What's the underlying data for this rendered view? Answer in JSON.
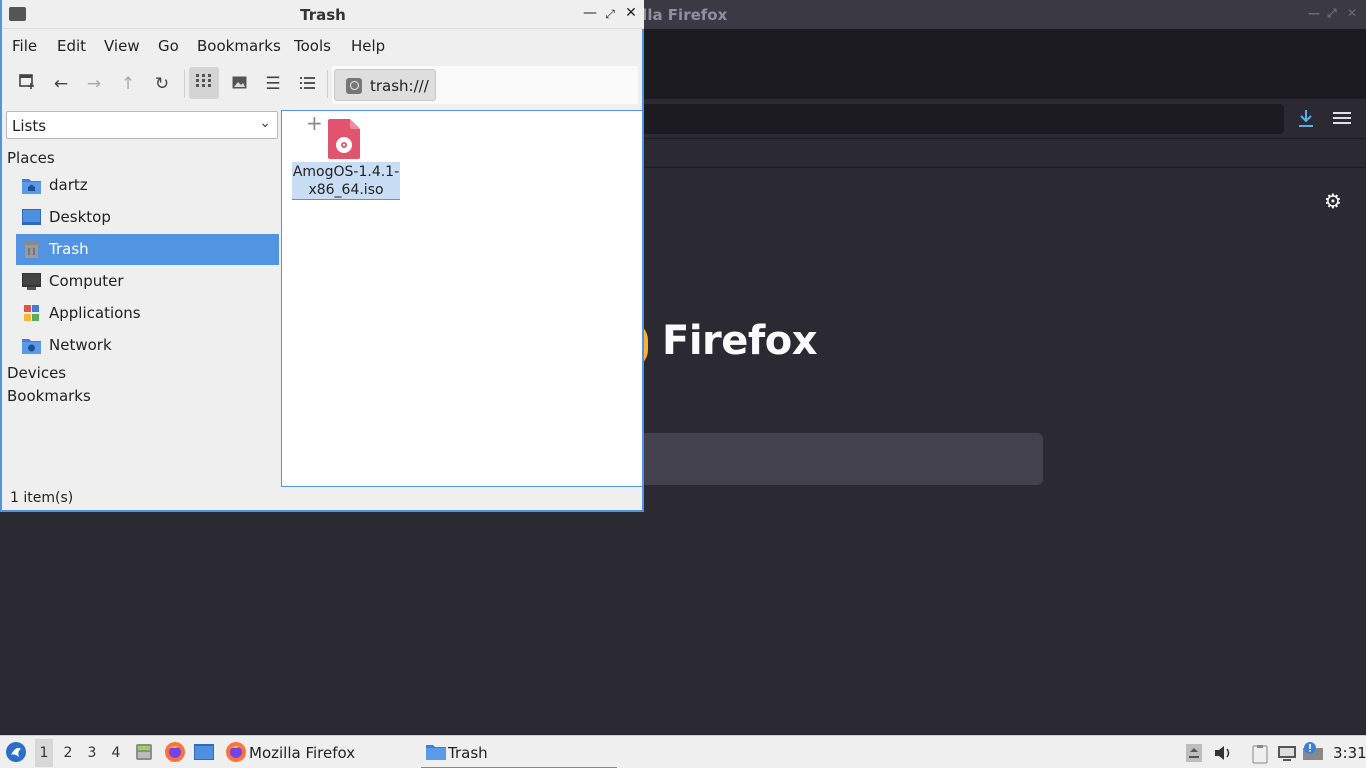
{
  "firefox": {
    "title": "Mozilla Firefox",
    "title_visible": "ozilla Firefox",
    "wordmark": "Firefox",
    "colors": {
      "background": "#2b2a33",
      "accent": "#54b1f0"
    }
  },
  "file_manager": {
    "title": "Trash",
    "menu": [
      "File",
      "Edit",
      "View",
      "Go",
      "Bookmarks",
      "Tools",
      "Help"
    ],
    "path": "trash:///",
    "side_pane_mode": "Lists",
    "sections": {
      "places": "Places",
      "devices": "Devices",
      "bookmarks": "Bookmarks"
    },
    "places": [
      {
        "label": "dartz",
        "icon": "home-folder-icon"
      },
      {
        "label": "Desktop",
        "icon": "desktop-icon"
      },
      {
        "label": "Trash",
        "icon": "trash-icon",
        "selected": true
      },
      {
        "label": "Computer",
        "icon": "computer-icon"
      },
      {
        "label": "Applications",
        "icon": "applications-icon"
      },
      {
        "label": "Network",
        "icon": "network-icon"
      }
    ],
    "files": [
      {
        "name": "AmogOS-1.4.1-x86_64.iso",
        "line1": "AmogOS-1.4.1-",
        "line2": "x86_64.iso",
        "icon": "disc-image-file-icon"
      }
    ],
    "status": "1 item(s)",
    "colors": {
      "accent": "#5294e2",
      "selection_bg": "#c9def5"
    }
  },
  "taskbar": {
    "desktops": [
      "1",
      "2",
      "3",
      "4"
    ],
    "active_desktop": "1",
    "tasks": [
      {
        "label": "Mozilla Firefox",
        "icon": "firefox-icon"
      },
      {
        "label": "Trash",
        "icon": "folder-icon",
        "active": true
      }
    ],
    "clock": "3:31"
  }
}
